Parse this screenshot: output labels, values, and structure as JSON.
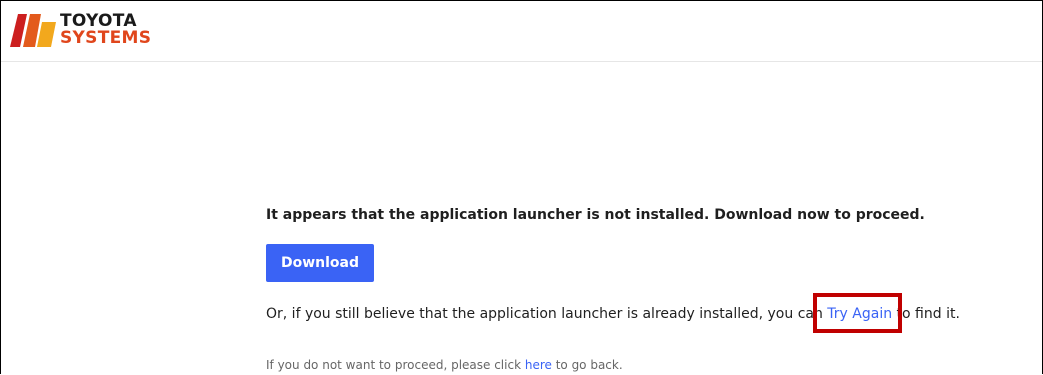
{
  "brand": {
    "line1": "TOYOTA",
    "line2": "SYSTEMS",
    "colors": {
      "mark_left": "#cc1f1f",
      "mark_middle": "#e35a1c",
      "mark_right": "#f2a81d",
      "text_dark": "#1a1a1a",
      "text_accent": "#e0461c"
    }
  },
  "message": {
    "headline": "It appears that the application launcher is not installed. Download now to proceed.",
    "download_label": "Download",
    "retry_prefix": "Or, if you still believe that the application launcher is already installed, you can ",
    "retry_link": "Try Again",
    "retry_suffix": " to find it.",
    "back_prefix": "If you do not want to proceed, please click ",
    "back_link": "here",
    "back_suffix": " to go back."
  },
  "colors": {
    "accent": "#3a63f5",
    "highlight": "#c00000"
  }
}
